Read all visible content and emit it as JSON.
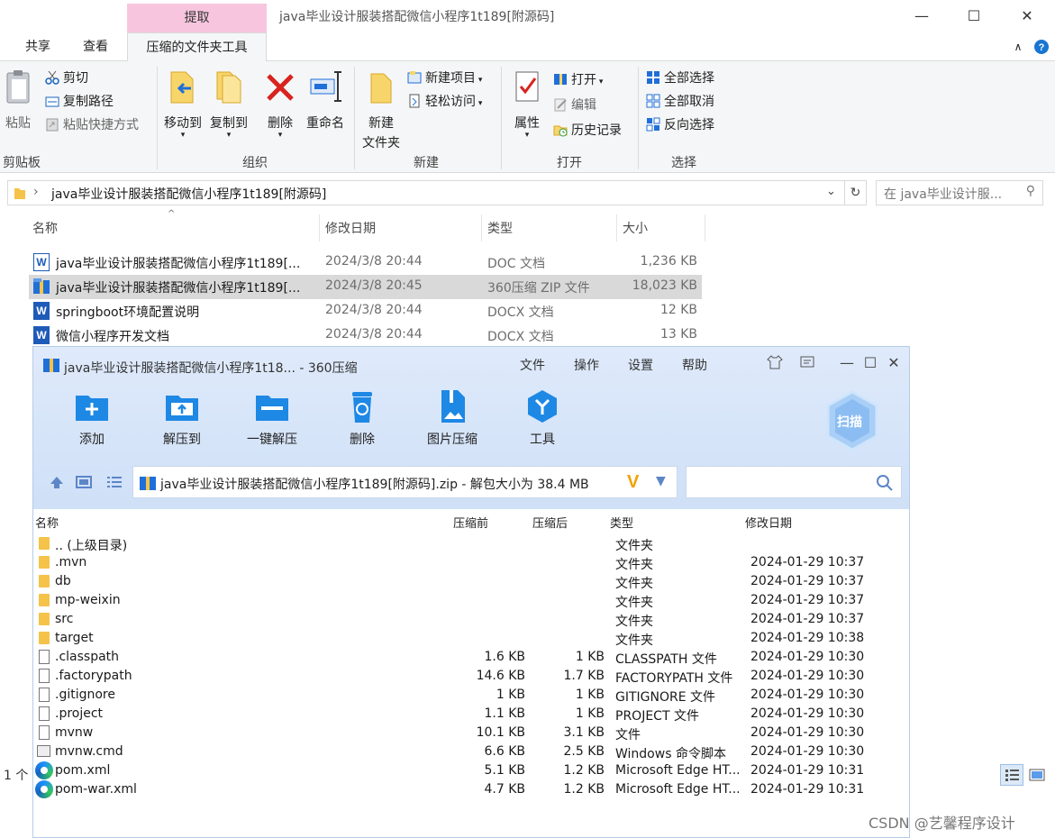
{
  "explorer": {
    "context_tab": "提取",
    "window_title": "java毕业设计服装搭配微信小程序1t189[附源码]",
    "window_buttons": {
      "minimize": "—",
      "maximize": "☐",
      "close": "✕"
    },
    "tabs": [
      {
        "label": "共享"
      },
      {
        "label": "查看"
      },
      {
        "label": "压缩的文件夹工具"
      }
    ],
    "ribbon": {
      "clipboard": {
        "paste": "粘贴",
        "cut": "剪切",
        "copy_path": "复制路径",
        "paste_shortcut": "粘贴快捷方式",
        "group": "剪贴板"
      },
      "organize": {
        "move_to": "移动到",
        "copy_to": "复制到",
        "delete": "删除",
        "rename": "重命名",
        "group": "组织"
      },
      "new": {
        "new_folder_line1": "新建",
        "new_folder_line2": "文件夹",
        "new_item": "新建项目",
        "easy_access": "轻松访问",
        "group": "新建"
      },
      "open": {
        "properties": "属性",
        "open": "打开",
        "edit": "编辑",
        "history": "历史记录",
        "group": "打开"
      },
      "select": {
        "select_all": "全部选择",
        "select_none": "全部取消",
        "invert": "反向选择",
        "group": "选择"
      }
    },
    "address": {
      "path": "java毕业设计服装搭配微信小程序1t189[附源码]",
      "search_placeholder": "在 java毕业设计服..."
    },
    "columns": {
      "name": "名称",
      "date": "修改日期",
      "type": "类型",
      "size": "大小"
    },
    "files": [
      {
        "name": "java毕业设计服装搭配微信小程序1t189[...",
        "date": "2024/3/8 20:44",
        "type": "DOC 文档",
        "size": "1,236 KB",
        "icon": "word-doc-icon"
      },
      {
        "name": "java毕业设计服装搭配微信小程序1t189[...",
        "date": "2024/3/8 20:45",
        "type": "360压缩 ZIP 文件",
        "size": "18,023 KB",
        "icon": "zip-archive-icon"
      },
      {
        "name": "springboot环境配置说明",
        "date": "2024/3/8 20:44",
        "type": "DOCX 文档",
        "size": "12 KB",
        "icon": "word-docx-icon"
      },
      {
        "name": "微信小程序开发文档",
        "date": "2024/3/8 20:44",
        "type": "DOCX 文档",
        "size": "13 KB",
        "icon": "word-docx-icon"
      }
    ],
    "status": "1 个"
  },
  "zip": {
    "title": "java毕业设计服装搭配微信小程序1t18... - 360压缩",
    "menu": [
      "文件",
      "操作",
      "设置",
      "帮助"
    ],
    "toolbar": [
      "添加",
      "解压到",
      "一键解压",
      "删除",
      "图片压缩",
      "工具"
    ],
    "scan": "扫描",
    "path": "java毕业设计服装搭配微信小程序1t189[附源码].zip - 解包大小为 38.4 MB",
    "path_logo": "V",
    "columns": {
      "name": "名称",
      "before": "压缩前",
      "after": "压缩后",
      "type": "类型",
      "date": "修改日期"
    },
    "rows": [
      {
        "name": ".. (上级目录)",
        "before": "",
        "after": "",
        "type": "文件夹",
        "date": "",
        "kind": "folder"
      },
      {
        "name": ".mvn",
        "before": "",
        "after": "",
        "type": "文件夹",
        "date": "2024-01-29 10:37",
        "kind": "folder"
      },
      {
        "name": "db",
        "before": "",
        "after": "",
        "type": "文件夹",
        "date": "2024-01-29 10:37",
        "kind": "folder"
      },
      {
        "name": "mp-weixin",
        "before": "",
        "after": "",
        "type": "文件夹",
        "date": "2024-01-29 10:37",
        "kind": "folder"
      },
      {
        "name": "src",
        "before": "",
        "after": "",
        "type": "文件夹",
        "date": "2024-01-29 10:37",
        "kind": "folder"
      },
      {
        "name": "target",
        "before": "",
        "after": "",
        "type": "文件夹",
        "date": "2024-01-29 10:38",
        "kind": "folder"
      },
      {
        "name": ".classpath",
        "before": "1.6 KB",
        "after": "1 KB",
        "type": "CLASSPATH 文件",
        "date": "2024-01-29 10:30",
        "kind": "file"
      },
      {
        "name": ".factorypath",
        "before": "14.6 KB",
        "after": "1.7 KB",
        "type": "FACTORYPATH 文件",
        "date": "2024-01-29 10:30",
        "kind": "file"
      },
      {
        "name": ".gitignore",
        "before": "1 KB",
        "after": "1 KB",
        "type": "GITIGNORE 文件",
        "date": "2024-01-29 10:30",
        "kind": "file"
      },
      {
        "name": ".project",
        "before": "1.1 KB",
        "after": "1 KB",
        "type": "PROJECT 文件",
        "date": "2024-01-29 10:30",
        "kind": "file"
      },
      {
        "name": "mvnw",
        "before": "10.1 KB",
        "after": "3.1 KB",
        "type": "文件",
        "date": "2024-01-29 10:30",
        "kind": "file"
      },
      {
        "name": "mvnw.cmd",
        "before": "6.6 KB",
        "after": "2.5 KB",
        "type": "Windows 命令脚本",
        "date": "2024-01-29 10:30",
        "kind": "cmd"
      },
      {
        "name": "pom.xml",
        "before": "5.1 KB",
        "after": "1.2 KB",
        "type": "Microsoft Edge HT...",
        "date": "2024-01-29 10:31",
        "kind": "edge"
      },
      {
        "name": "pom-war.xml",
        "before": "4.7 KB",
        "after": "1.2 KB",
        "type": "Microsoft Edge HT...",
        "date": "2024-01-29 10:31",
        "kind": "edge"
      }
    ]
  },
  "watermark": "CSDN @艺馨程序设计"
}
